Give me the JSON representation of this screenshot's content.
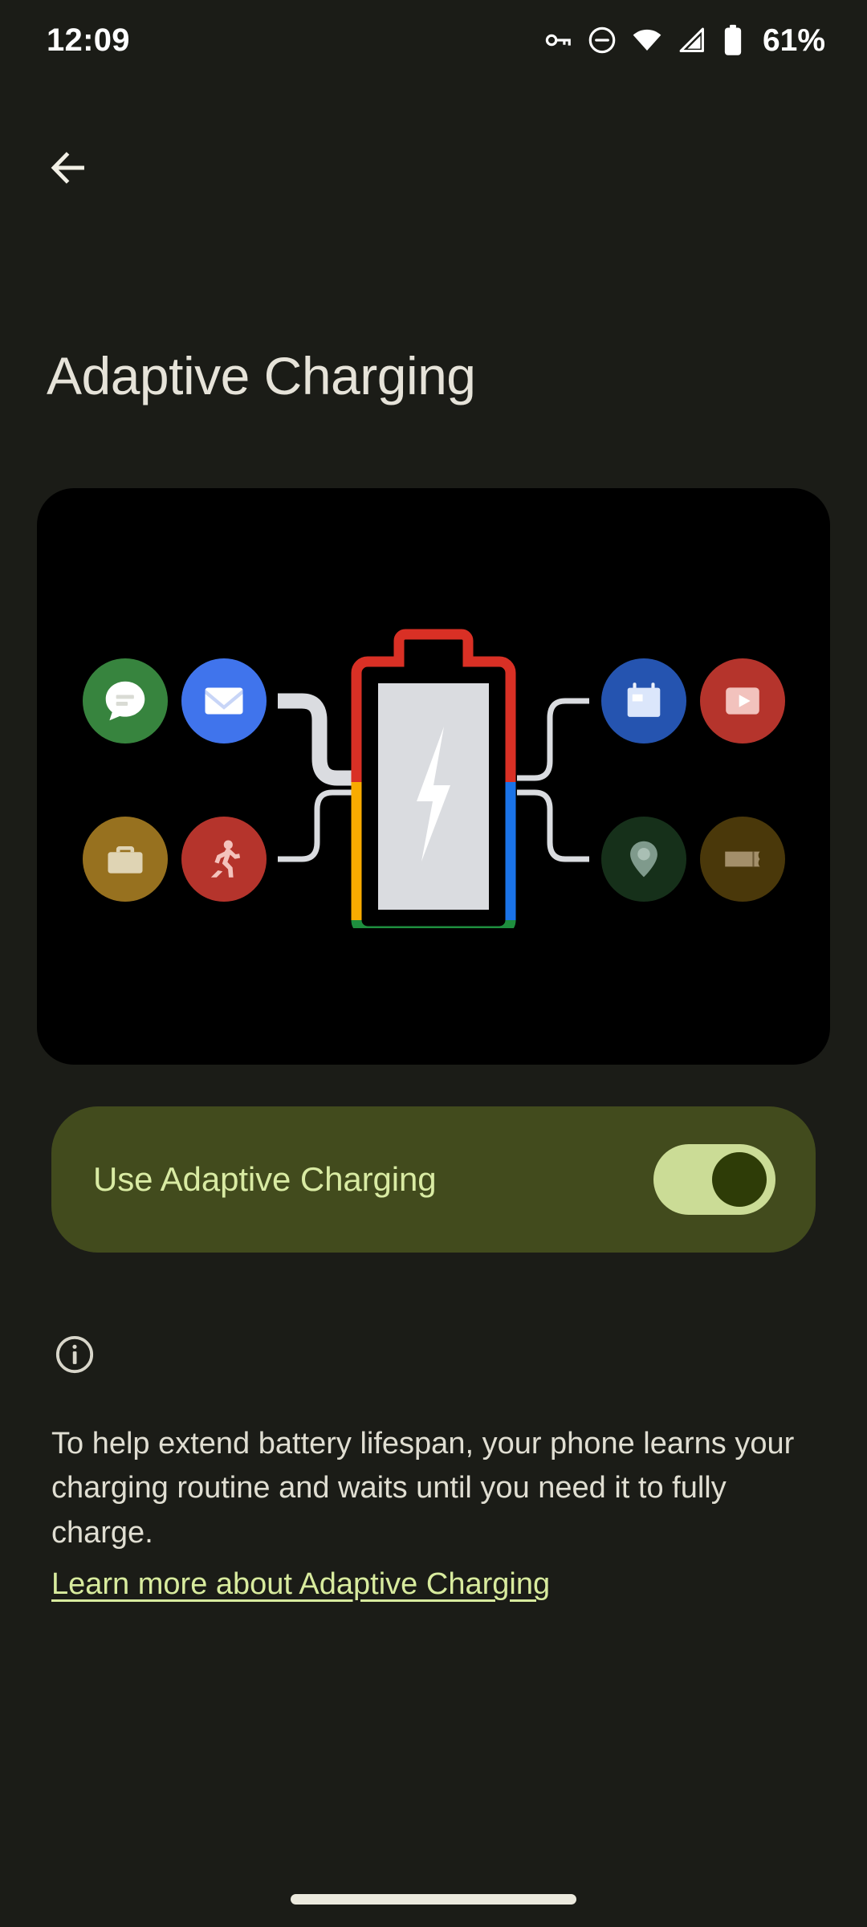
{
  "status_bar": {
    "time": "12:09",
    "battery_percent": "61%",
    "icons": [
      "vpn-key-icon",
      "do-not-disturb-icon",
      "wifi-icon",
      "cellular-signal-icon",
      "battery-icon"
    ]
  },
  "nav": {
    "back_label": "Back",
    "back_icon": "arrow-left-icon"
  },
  "header": {
    "title": "Adaptive Charging"
  },
  "illustration": {
    "alt": "Adaptive charging illustration",
    "center_icon": "battery-charging-icon",
    "left_apps": [
      {
        "name": "messages",
        "icon": "chat-bubble-icon",
        "color": "#37843e"
      },
      {
        "name": "mail",
        "icon": "envelope-icon",
        "color": "#4074ec"
      },
      {
        "name": "work",
        "icon": "briefcase-icon",
        "color": "#97711f"
      },
      {
        "name": "fitness",
        "icon": "running-person-icon",
        "color": "#b5342c"
      }
    ],
    "right_apps": [
      {
        "name": "calendar",
        "icon": "calendar-icon",
        "color": "#2554b0"
      },
      {
        "name": "video",
        "icon": "play-rectangle-icon",
        "color": "#b5342c"
      },
      {
        "name": "maps",
        "icon": "location-pin-icon",
        "color": "#16301a"
      },
      {
        "name": "tickets",
        "icon": "ticket-icon",
        "color": "#4a380a"
      }
    ],
    "battery_colors": {
      "top": "#d93025",
      "left": "#f9ab00",
      "right": "#1a73e8",
      "bottom": "#1e8e3e",
      "fill": "#dadce0",
      "bolt": "#ffffff"
    }
  },
  "setting": {
    "label": "Use Adaptive Charging",
    "enabled": true,
    "track_color": "#cbdc96",
    "thumb_color": "#2e3c07",
    "card_color": "#424b1d"
  },
  "footer": {
    "info_icon": "info-circle-icon",
    "description": "To help extend battery lifespan, your phone learns your charging routine and waits until you need it to fully charge.",
    "link_text": "Learn more about Adaptive Charging",
    "link_color": "#d8eb9e"
  },
  "system": {
    "gesture_bar": "home-gesture-bar"
  }
}
